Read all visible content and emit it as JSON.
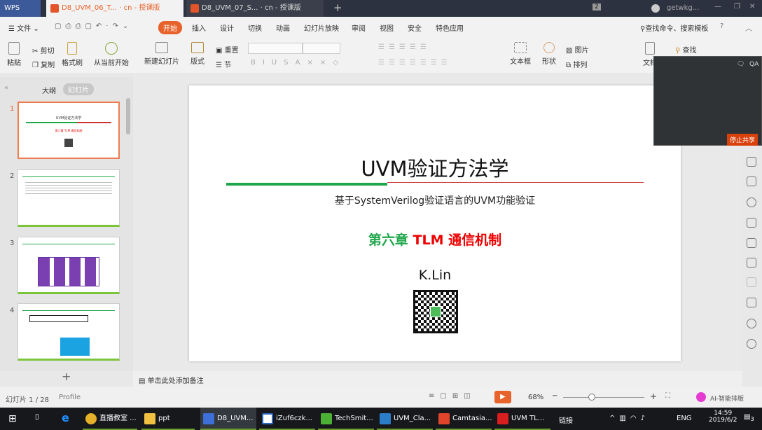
{
  "tabs": {
    "app": "WPS",
    "tab1": "D8_UVM_06_T... · cn - 授课版",
    "tab2": "D8_UVM_07_S... · cn - 授课版",
    "new": "+",
    "badge": "2",
    "user": "getwkg..."
  },
  "menu": {
    "file": "文件",
    "items": [
      "开始",
      "插入",
      "设计",
      "切换",
      "动画",
      "幻灯片放映",
      "审阅",
      "视图",
      "安全",
      "特色应用"
    ],
    "search": "查找命令、搜索模板",
    "help": "?"
  },
  "toolbar": {
    "paste": "粘贴",
    "cut": "剪切",
    "copy": "复制",
    "format_painter": "格式刷",
    "play_from_current": "从当前开始",
    "new_slide": "新建幻灯片",
    "layout": "版式",
    "reset": "重置",
    "section": "节",
    "textbox": "文本框",
    "shape": "形状",
    "picture": "图片",
    "arrange": "排列",
    "doc": "文档",
    "find": "查找"
  },
  "left_panel": {
    "outline_tab": "大纲",
    "slides_tab": "幻灯片",
    "slides": [
      "1",
      "2",
      "3",
      "4"
    ],
    "add": "+"
  },
  "slide": {
    "title": "UVM验证方法学",
    "subtitle": "基于SystemVerilog验证语言的UVM功能验证",
    "chapter": "第六章",
    "tlm": "TLM",
    "topic": "通信机制",
    "author": "K.Lin"
  },
  "notes": {
    "placeholder": "单击此处添加备注"
  },
  "status": {
    "slide_counter": "幻灯片 1 / 28",
    "profile": "Profile",
    "zoom": "68%",
    "ai": "AI-智能排版"
  },
  "video": {
    "stop_share": "停止共享",
    "qa": "QA"
  },
  "taskbar": {
    "items": [
      "直播教室 ...",
      "ppt",
      "D8_UVM...",
      "iZuf6czk...",
      "TechSmit...",
      "UVM_Cla...",
      "Camtasia...",
      "UVM TL..."
    ],
    "link": "链接",
    "lang": "ENG",
    "time": "14:59",
    "date": "2019/6/2",
    "notif": "3"
  },
  "colors": {
    "accent": "#e8632c",
    "green": "#1fa64a",
    "red": "#e00000"
  }
}
